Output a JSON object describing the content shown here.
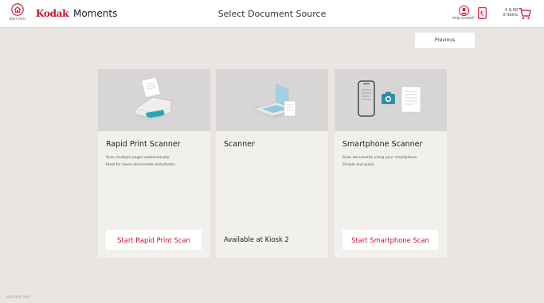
{
  "header": {
    "start_over_label": "Start Over",
    "brand_name": "Kodak",
    "brand_suffix": "Moments",
    "title": "Select Document Source",
    "help_label": "Help needed?",
    "cart_amount": "€ 0,00",
    "cart_items": "0 items"
  },
  "toolbar": {
    "previous_label": "Previous"
  },
  "cards": [
    {
      "title": "Rapid Print Scanner",
      "desc_lines": [
        "Scan multiple pages automatically.",
        "Ideal for loose documents and photos."
      ],
      "action_label": "Start Rapid Print Scan"
    },
    {
      "title": "Scanner",
      "status": "Available at Kiosk 2"
    },
    {
      "title": "Smartphone Scanner",
      "desc_lines": [
        "Scan documents using your smartphone.",
        "Simple and quick."
      ],
      "action_label": "Start Smartphone Scan"
    }
  ],
  "footer": {
    "version": "W10 VPH 10A i"
  },
  "colors": {
    "accent": "#c8102e",
    "background": "#e9e6e1",
    "card": "#f2f0ec",
    "card_image": "#d8d5d6"
  },
  "icons": {
    "start_over": "home-icon",
    "help": "user-help-icon",
    "currency": "euro-receipt-icon",
    "cart": "shopping-cart-icon"
  }
}
